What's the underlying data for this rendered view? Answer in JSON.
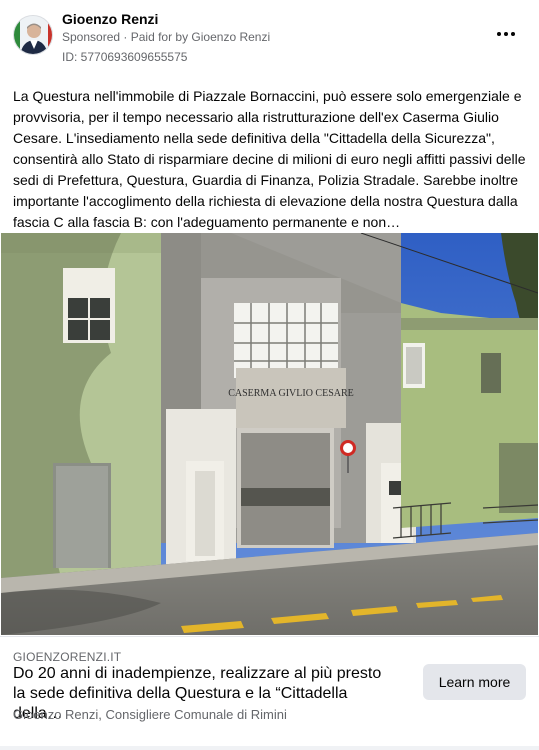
{
  "post": {
    "author": "Gioenzo Renzi",
    "sponsored_label": "Sponsored",
    "separator": " · ",
    "paid_for": "Paid for by Gioenzo Renzi",
    "ad_id": "ID: 5770693609655575",
    "more_icon": "more-horizontal-icon",
    "body": "La Questura nell'immobile di Piazzale Bornaccini, può essere solo emergenziale e provvisoria, per il tempo necessario alla ristrutturazione dell'ex Caserma Giulio Cesare. L'insediamento nella sede definitiva della \"Cittadella della Sicurezza\", consentirà allo Stato di risparmiare decine di milioni di euro negli affitti passivi delle sedi di Prefettura, Questura, Guardia di Finanza, Polizia Stradale. Sarebbe inoltre importante l'accoglimento della richiesta di elevazione della nostra Questura dalla fascia C alla fascia B: con l'adeguamento permanente e non…"
  },
  "photo": {
    "sign_text": "CASERMA GIVLIO CESARE"
  },
  "link": {
    "domain": "GIOENZORENZI.IT",
    "headline": "Do 20 anni di inadempienze, realizzare al più presto la sede definitiva della Questura e la “Cittadella della…",
    "description": "Gioenzo Renzi, Consigliere Comunale di Rimini",
    "cta_label": "Learn more"
  },
  "colors": {
    "secondary_text": "#65676b",
    "button_bg": "#e4e6eb",
    "sky": "#3b6fd0",
    "wall_green": "#b9c99a"
  }
}
